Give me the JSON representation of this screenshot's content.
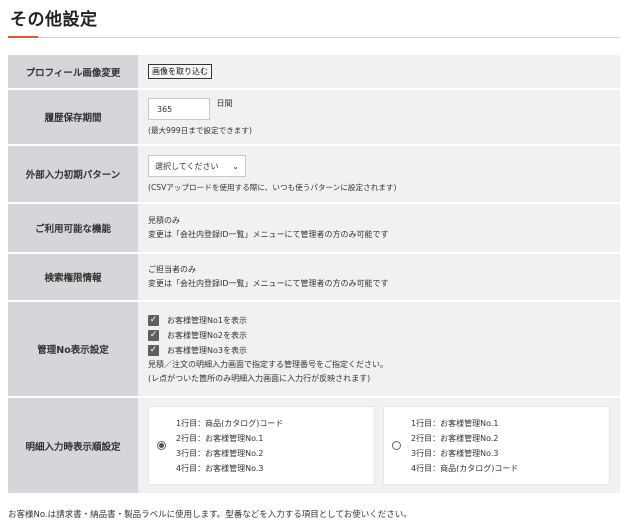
{
  "page": {
    "title": "その他設定",
    "accent_color": "#e25a2c"
  },
  "rows": {
    "profile": {
      "label": "プロフィール画像変更",
      "button": "画像を取り込む"
    },
    "history": {
      "label": "履歴保存期間",
      "value": "365",
      "unit": "日間",
      "note": "(最大999日まで設定できます)"
    },
    "external": {
      "label": "外部入力初期パターン",
      "select_value": "選択してください",
      "note": "(CSVアップロードを使用する際に、いつも使うパターンに設定されます)"
    },
    "features": {
      "label": "ご利用可能な機能",
      "line1": "見積のみ",
      "line2": "変更は「会社内登録ID一覧」メニューにて管理者の方のみ可能です"
    },
    "search": {
      "label": "検索権限情報",
      "line1": "ご担当者のみ",
      "line2": "変更は「会社内登録ID一覧」メニューにて管理者の方のみ可能です"
    },
    "mgmt": {
      "label": "管理No表示設定",
      "checks": [
        "お客様管理No1を表示",
        "お客様管理No2を表示",
        "お客様管理No3を表示"
      ],
      "note1": "見積／注文の明細入力画面で指定する管理番号をご指定ください。",
      "note2": "(レ点がついた箇所のみ明細入力画面に入力行が反映されます)"
    },
    "order": {
      "label": "明細入力時表示順設定",
      "option_a": [
        "1行目：商品(カタログ)コード",
        "2行目：お客様管理No.1",
        "3行目：お客様管理No.2",
        "4行目：お客様管理No.3"
      ],
      "option_b": [
        "1行目：お客様管理No.1",
        "2行目：お客様管理No.2",
        "3行目：お客様管理No.3",
        "4行目：商品(カタログ)コード"
      ]
    }
  },
  "footer": {
    "note": "お客様No.は請求書・納品書・製品ラベルに使用します。型番などを入力する項目としてお使いください。"
  }
}
